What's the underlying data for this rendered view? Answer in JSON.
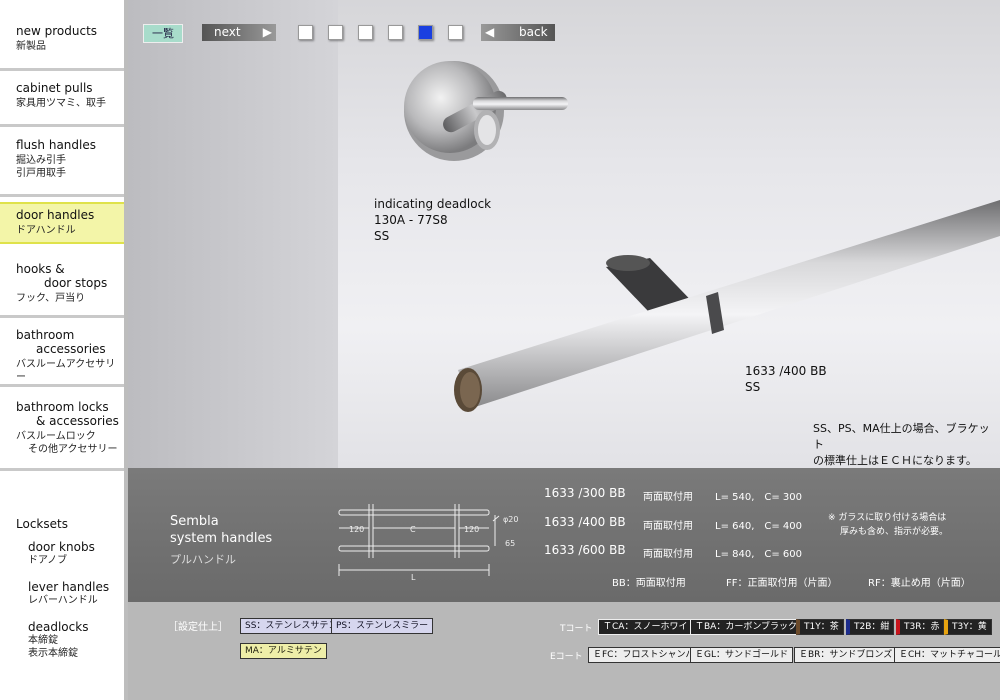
{
  "sidebar": {
    "items": [
      {
        "en": "new products",
        "jp": "新製品"
      },
      {
        "en": "cabinet pulls",
        "jp": "家具用ツマミ、取手"
      },
      {
        "en": "flush handles",
        "jp": "掘込み引手",
        "jp2": "引戸用取手"
      },
      {
        "en": "door handles",
        "jp": "ドアハンドル"
      },
      {
        "en": "hooks &",
        "en2": "door stops",
        "jp": "フック、戸当り"
      },
      {
        "en": "bathroom",
        "en2": "accessories",
        "jp": "バスルームアクセサリー"
      },
      {
        "en": "bathroom locks",
        "en2": "& accessories",
        "jp": "バスルームロック",
        "jp2": "その他アクセサリー"
      },
      {
        "en": "Locksets"
      },
      {
        "en": "door knobs",
        "jp": "ドアノブ"
      },
      {
        "en": "lever handles",
        "jp": "レバーハンドル"
      },
      {
        "en": "deadlocks",
        "jp": "本締錠",
        "jp2": "表示本締錠"
      }
    ]
  },
  "toolbar": {
    "list_label": "一覧",
    "next_label": "next",
    "back_label": "back",
    "page_count": 6,
    "active_page": 5
  },
  "photo": {
    "deadlock": {
      "name": "indicating deadlock",
      "code": "130A - 77S8",
      "finish": "SS"
    },
    "handle": {
      "code": "1633 /400 BB",
      "finish": "SS"
    },
    "note1": "SS、PS、MA仕上の場合、ブラケット",
    "note2": "の標準仕上はＥＣＨになります。"
  },
  "info": {
    "title1": "Sembla",
    "title2": "system handles",
    "title_jp": "プルハンドル",
    "dims": {
      "phi": "φ20",
      "a": "120",
      "c": "C",
      "b": "120",
      "h": "65",
      "l": "L"
    },
    "rows": [
      {
        "code": "1633 /300 BB",
        "mount": "両面取付用",
        "spec": "L= 540,　C= 300"
      },
      {
        "code": "1633 /400 BB",
        "mount": "両面取付用",
        "spec": "L= 640,　C= 400"
      },
      {
        "code": "1633 /600 BB",
        "mount": "両面取付用",
        "spec": "L= 840,　C= 600"
      }
    ],
    "glass1": "※ ガラスに取り付ける場合は",
    "glass2": "厚みも含め、指示が必要。",
    "legend_bb": "BB：両面取付用",
    "legend_ff": "FF：正面取付用（片面）",
    "legend_rf": "RF：裏止め用（片面）"
  },
  "finishes": {
    "label": "［設定仕上］",
    "ss": "SS：ステンレスサテン",
    "ps": "PS：ステンレスミラー",
    "ma": "MA：アルミサテン",
    "t_label": "Tコート",
    "tca": "ＴCA：スノーホワイト",
    "tba": "ＴBA：カーボンブラック",
    "t1y": "T1Y：茶",
    "t2b": "T2B：紺",
    "t3r": "T3R：赤",
    "t3y": "T3Y：黄",
    "e_label": "Eコート",
    "efc": "ＥFC：フロストシャンパン",
    "egl": "ＥGL：サンドゴールド",
    "ebr": "ＥBR：サンドブロンズ",
    "ech": "ＥCH：マットチャコール"
  }
}
